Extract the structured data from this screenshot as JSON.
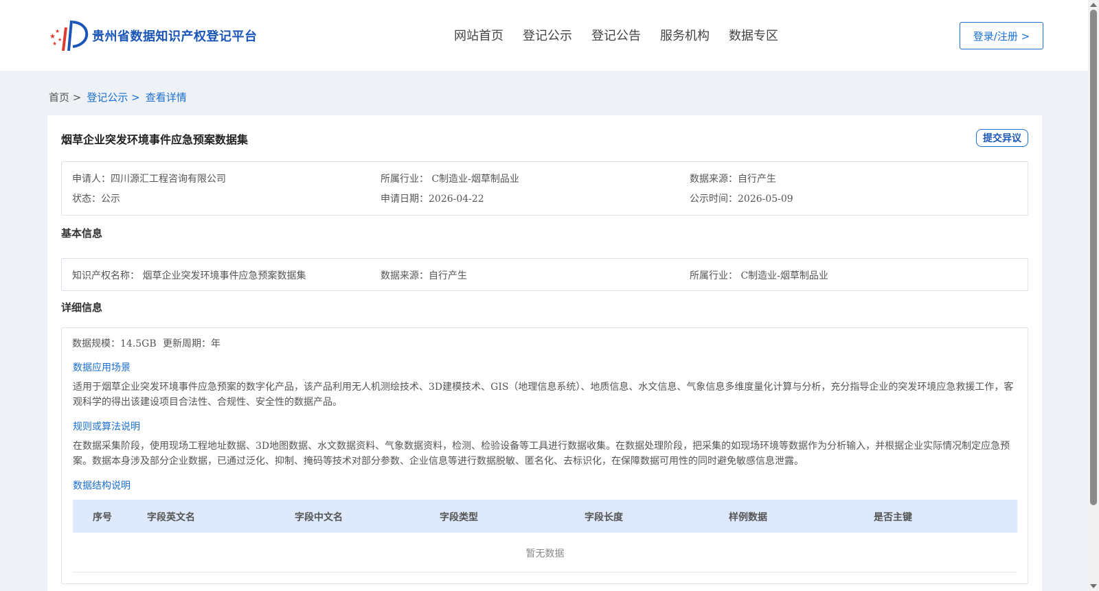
{
  "header": {
    "site_name": "贵州省数据知识产权登记平台",
    "nav": [
      "网站首页",
      "登记公示",
      "登记公告",
      "服务机构",
      "数据专区"
    ],
    "login_label": "登录/注册 >"
  },
  "breadcrumb": {
    "home": "首页 >",
    "section": "登记公示 >",
    "current": "查看详情"
  },
  "record": {
    "title": "烟草企业突发环境事件应急预案数据集",
    "dispute_label": "提交异议",
    "summary": {
      "applicant": "申请人：四川源汇工程咨询有限公司",
      "industry": "所属行业： C制造业-烟草制品业",
      "source": "数据来源：自行产生",
      "status": "状态：公示",
      "apply_date": "申请日期：2026-04-22",
      "publish_time": "公示时间：2026-05-09"
    }
  },
  "basic_info": {
    "heading": "基本信息",
    "ip_name": "知识产权名称： 烟草企业突发环境事件应急预案数据集",
    "source": "数据来源：自行产生",
    "industry": "所属行业： C制造业-烟草制品业"
  },
  "detail_info": {
    "heading": "详细信息",
    "scale": "数据规模：14.5GB",
    "cycle": "更新周期：年",
    "scenario_heading": "数据应用场景",
    "scenario_text": "适用于烟草企业突发环境事件应急预案的数字化产品，该产品利用无人机测绘技术、3D建模技术、GIS（地理信息系统）、地质信息、水文信息、气象信息多维度量化计算与分析，充分指导企业的突发环境应急救援工作，客观科学的得出该建设项目合法性、合规性、安全性的数据产品。",
    "rules_heading": "规则或算法说明",
    "rules_text": "在数据采集阶段，使用现场工程地址数据、3D地图数据、水文数据资料、气象数据资料，检测、检验设备等工具进行数据收集。在数据处理阶段，把采集的如现场环境等数据作为分析输入，并根据企业实际情况制定应急预案。数据本身涉及部分企业数据，已通过泛化、抑制、掩码等技术对部分参数、企业信息等进行数据脱敏、匿名化、去标识化，在保障数据可用性的同时避免敏感信息泄露。",
    "structure_heading": "数据结构说明",
    "table_headers": [
      "序号",
      "字段英文名",
      "字段中文名",
      "字段类型",
      "字段长度",
      "样例数据",
      "是否主键"
    ],
    "empty_text": "暂无数据"
  },
  "colors": {
    "brand": "#1a56b8",
    "link": "#1a6fd1",
    "table_header_bg": "#deeafb",
    "page_bg": "#eef1f5"
  }
}
